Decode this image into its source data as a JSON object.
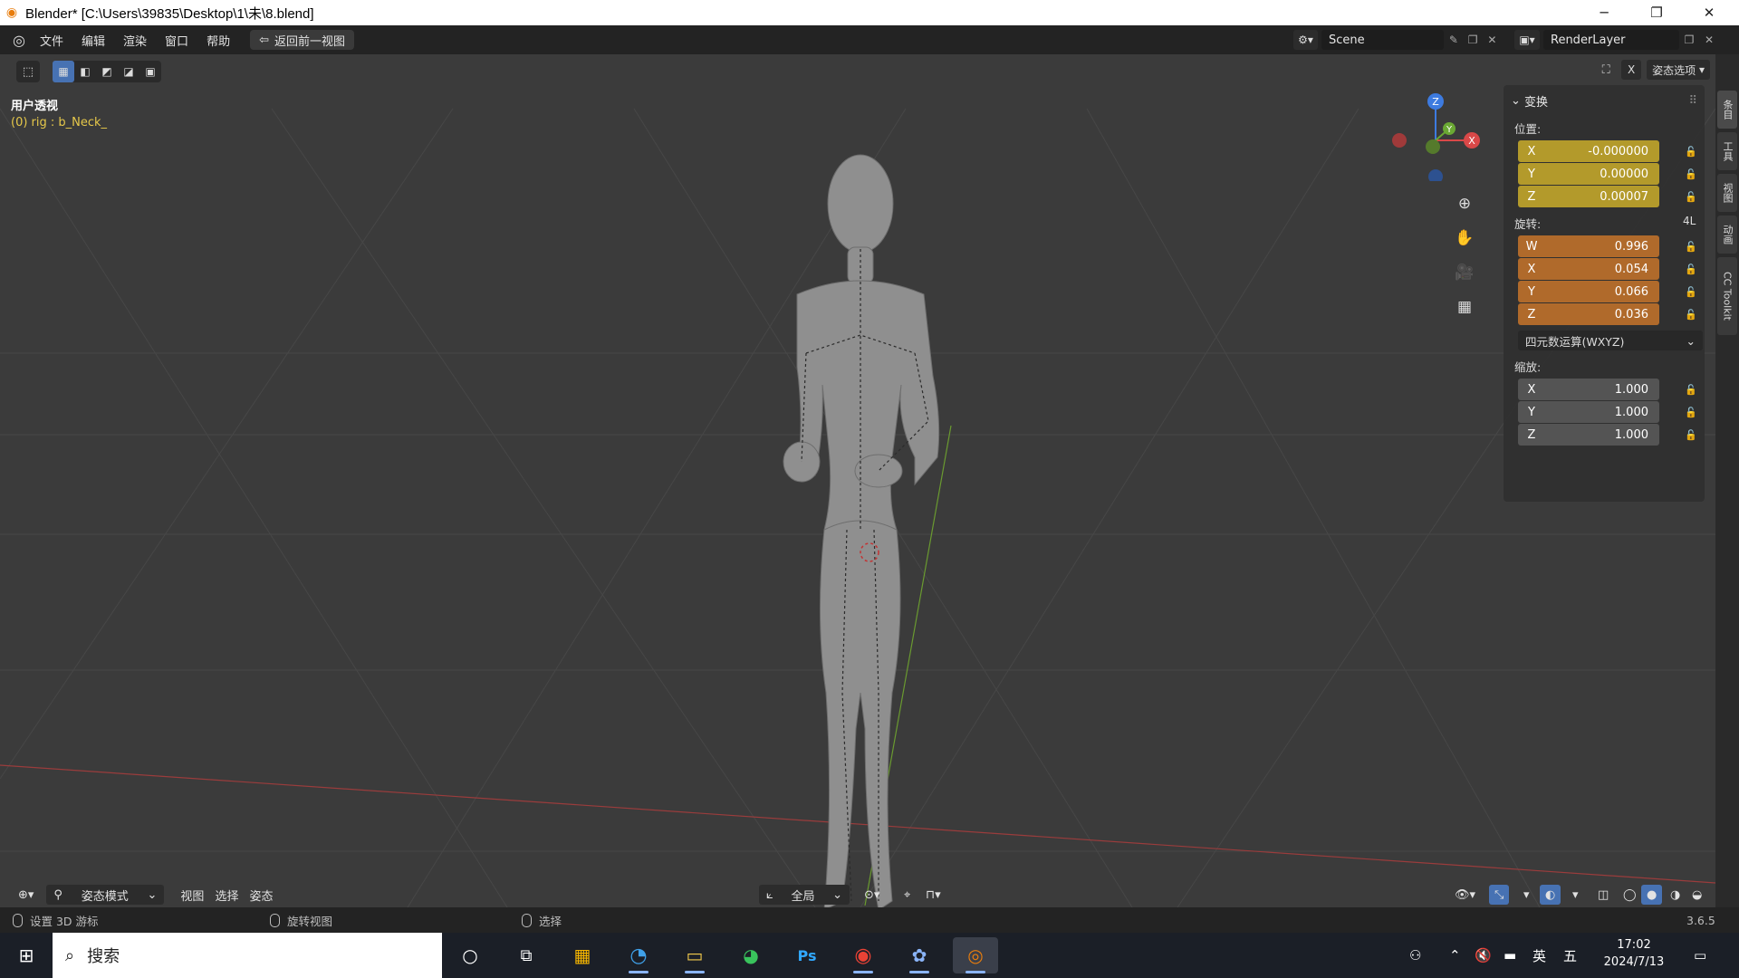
{
  "window": {
    "title": "Blender* [C:\\Users\\39835\\Desktop\\1\\未\\8.blend]",
    "controls": [
      "─",
      "❐",
      "✕"
    ]
  },
  "menubar": {
    "items": [
      "文件",
      "编辑",
      "渲染",
      "窗口",
      "帮助"
    ],
    "back_button": "返回前一视图",
    "scene_name": "Scene",
    "render_layer": "RenderLayer"
  },
  "viewport": {
    "view_name": "用户透视",
    "active_info": "(0) rig : b_Neck_",
    "pose_options": "姿态选项",
    "gizmo_axes": [
      "Z",
      "Y",
      "X"
    ]
  },
  "transform_panel": {
    "title": "变换",
    "location_label": "位置:",
    "location": [
      {
        "axis": "X",
        "value": "-0.000000"
      },
      {
        "axis": "Y",
        "value": "0.00000"
      },
      {
        "axis": "Z",
        "value": "0.00007"
      }
    ],
    "rotation_label": "旋转:",
    "rotation_lock": "4L",
    "rotation": [
      {
        "axis": "W",
        "value": "0.996"
      },
      {
        "axis": "X",
        "value": "0.054"
      },
      {
        "axis": "Y",
        "value": "0.066"
      },
      {
        "axis": "Z",
        "value": "0.036"
      }
    ],
    "rotation_mode": "四元数运算(WXYZ)",
    "scale_label": "缩放:",
    "scale": [
      {
        "axis": "X",
        "value": "1.000"
      },
      {
        "axis": "Y",
        "value": "1.000"
      },
      {
        "axis": "Z",
        "value": "1.000"
      }
    ]
  },
  "side_tabs": [
    "条目",
    "工具",
    "视图",
    "动画",
    "CC Toolkit"
  ],
  "viewport_footer": {
    "mode": "姿态模式",
    "menus": [
      "视图",
      "选择",
      "姿态"
    ],
    "transform_orientation": "全局"
  },
  "statusbar": {
    "left": "设置 3D 游标",
    "middle": "旋转视图",
    "right": "选择",
    "version": "3.6.5"
  },
  "taskbar": {
    "search_placeholder": "搜索",
    "time": "17:02",
    "date": "2024/7/13",
    "ime_lang": "英",
    "ime_mode": "五"
  },
  "colors": {
    "accent": "#4772b3",
    "location_field": "#b39a2b",
    "rotation_field": "#b06a2b",
    "active_text": "#e6c84a"
  }
}
